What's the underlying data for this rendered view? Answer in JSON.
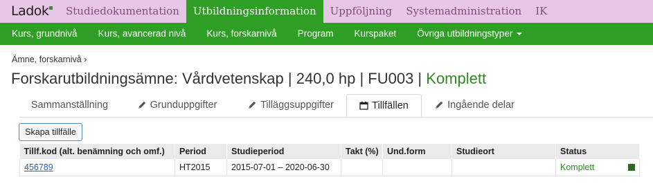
{
  "app": {
    "logo_text": "Ladok",
    "top_nav": [
      {
        "label": "Studiedokumentation",
        "active": false
      },
      {
        "label": "Utbildningsinformation",
        "active": true
      },
      {
        "label": "Uppföljning",
        "active": false
      },
      {
        "label": "Systemadministration",
        "active": false
      },
      {
        "label": "IK",
        "active": false
      }
    ]
  },
  "sub_nav": {
    "items": [
      "Kurs, grundnivå",
      "Kurs, avancerad nivå",
      "Kurs, forskarnivå",
      "Program",
      "Kurspaket",
      "Övriga utbildningstyper"
    ],
    "dropdown_index": 5
  },
  "breadcrumb": {
    "text": "Ämne, forskarnivå",
    "separator": "›"
  },
  "page_title": {
    "main": "Forskarutbildningsämne: Vårdvetenskap | 240,0 hp | FU003 |",
    "status": "Komplett",
    "status_color": "#2f8a22"
  },
  "tabs": [
    {
      "label": "Sammanställning",
      "icon": null,
      "active": false
    },
    {
      "label": "Grunduppgifter",
      "icon": "pencil-icon",
      "active": false
    },
    {
      "label": "Tilläggsuppgifter",
      "icon": "pencil-icon",
      "active": false
    },
    {
      "label": "Tillfällen",
      "icon": "calendar-icon",
      "active": true
    },
    {
      "label": "Ingående delar",
      "icon": "pencil-icon",
      "active": false
    }
  ],
  "actions": {
    "create_label": "Skapa tillfälle"
  },
  "table": {
    "headers": [
      "Tillf.kod (alt. benämning och omf.)",
      "Period",
      "Studieperiod",
      "Takt (%)",
      "Und.form",
      "Studieort",
      "Status"
    ],
    "rows": [
      {
        "code": "456789",
        "period": "HT2015",
        "studieperiod": "2015-07-01 – 2020-06-30",
        "takt": "",
        "undform": "",
        "studieort": "",
        "status": "Komplett"
      }
    ]
  },
  "colors": {
    "accent_green": "#2f9e25",
    "top_bar": "#e8c6e6",
    "top_text": "#7d4e7a",
    "link": "#2b65b2"
  }
}
